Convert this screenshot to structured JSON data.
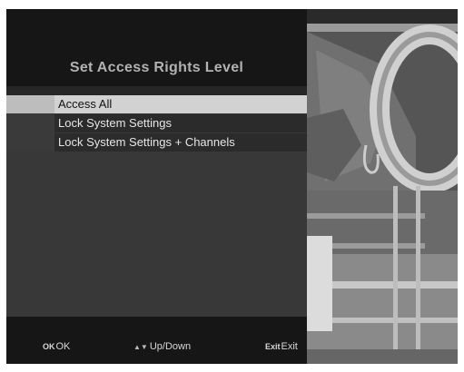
{
  "menu": {
    "title": "Set Access Rights Level",
    "items": [
      {
        "label": "Access All",
        "selected": true
      },
      {
        "label": "Lock System Settings",
        "selected": false
      },
      {
        "label": "Lock System Settings + Channels",
        "selected": false
      }
    ]
  },
  "footer": {
    "ok_key": "OK",
    "ok_label": "OK",
    "updown_icon": "up-down-arrows-icon",
    "updown_label": "Up/Down",
    "exit_key": "Exit",
    "exit_label": "Exit"
  },
  "video_preview": {
    "description_icon": "tv-live-video"
  }
}
